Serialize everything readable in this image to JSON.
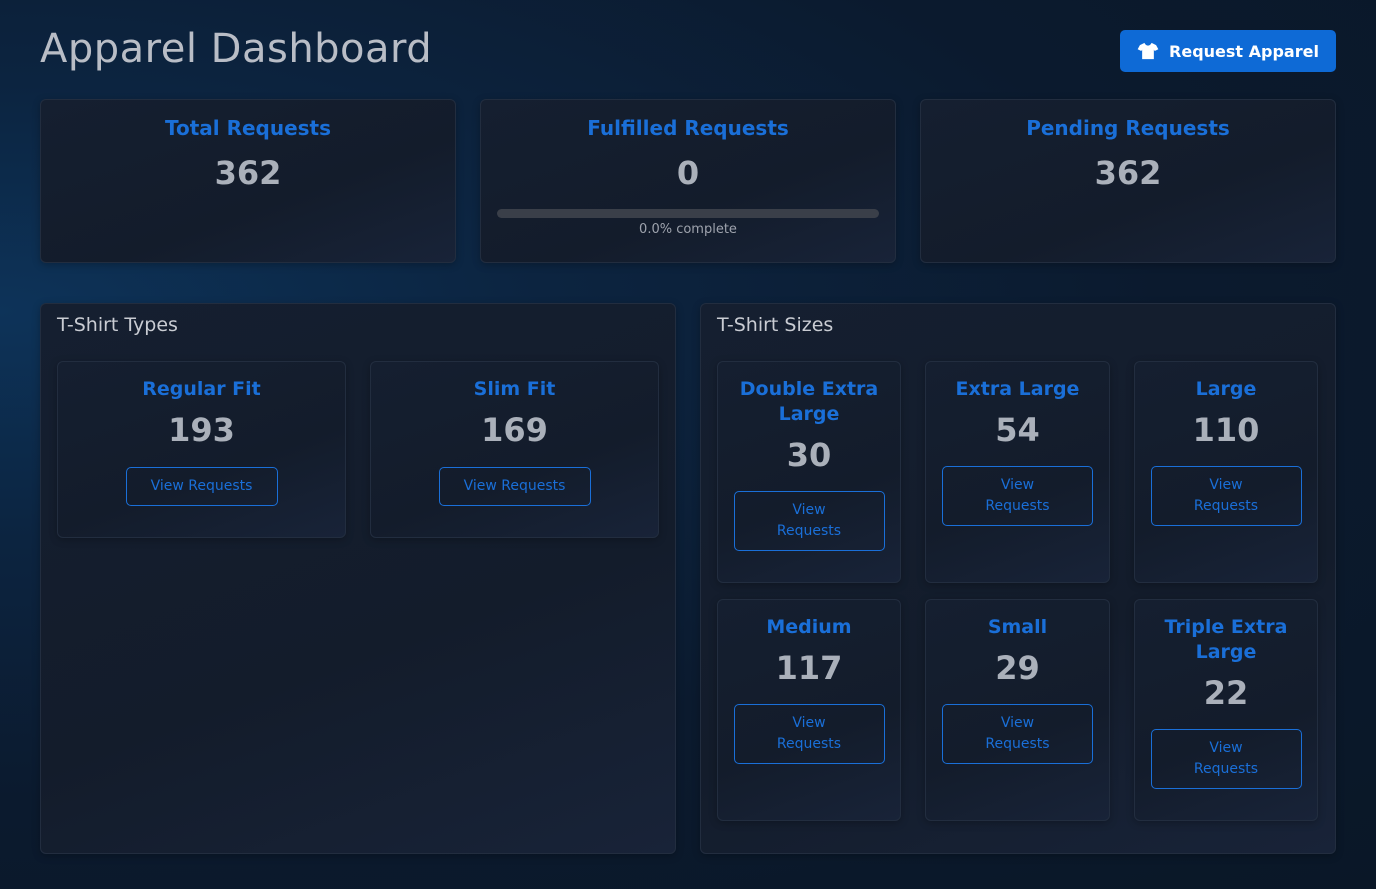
{
  "header": {
    "title": "Apparel Dashboard",
    "request_button": "Request Apparel",
    "request_icon": "tshirt-icon"
  },
  "stats": {
    "total": {
      "label": "Total Requests",
      "value": "362"
    },
    "fulfilled": {
      "label": "Fulfilled Requests",
      "value": "0",
      "progress_percent": 0.0,
      "progress_text": "0.0% complete"
    },
    "pending": {
      "label": "Pending Requests",
      "value": "362"
    }
  },
  "types": {
    "title": "T-Shirt Types",
    "items": [
      {
        "label": "Regular Fit",
        "value": "193",
        "button": "View Requests"
      },
      {
        "label": "Slim Fit",
        "value": "169",
        "button": "View Requests"
      }
    ]
  },
  "sizes": {
    "title": "T-Shirt Sizes",
    "items": [
      {
        "label": "Double Extra Large",
        "value": "30",
        "button": "View Requests"
      },
      {
        "label": "Extra Large",
        "value": "54",
        "button": "View Requests"
      },
      {
        "label": "Large",
        "value": "110",
        "button": "View Requests"
      },
      {
        "label": "Medium",
        "value": "117",
        "button": "View Requests"
      },
      {
        "label": "Small",
        "value": "29",
        "button": "View Requests"
      },
      {
        "label": "Triple Extra Large",
        "value": "22",
        "button": "View Requests"
      }
    ]
  },
  "colors": {
    "accent": "#0e6ad6",
    "label_blue": "#1a6fd8",
    "value_gray": "#aab0ba"
  }
}
